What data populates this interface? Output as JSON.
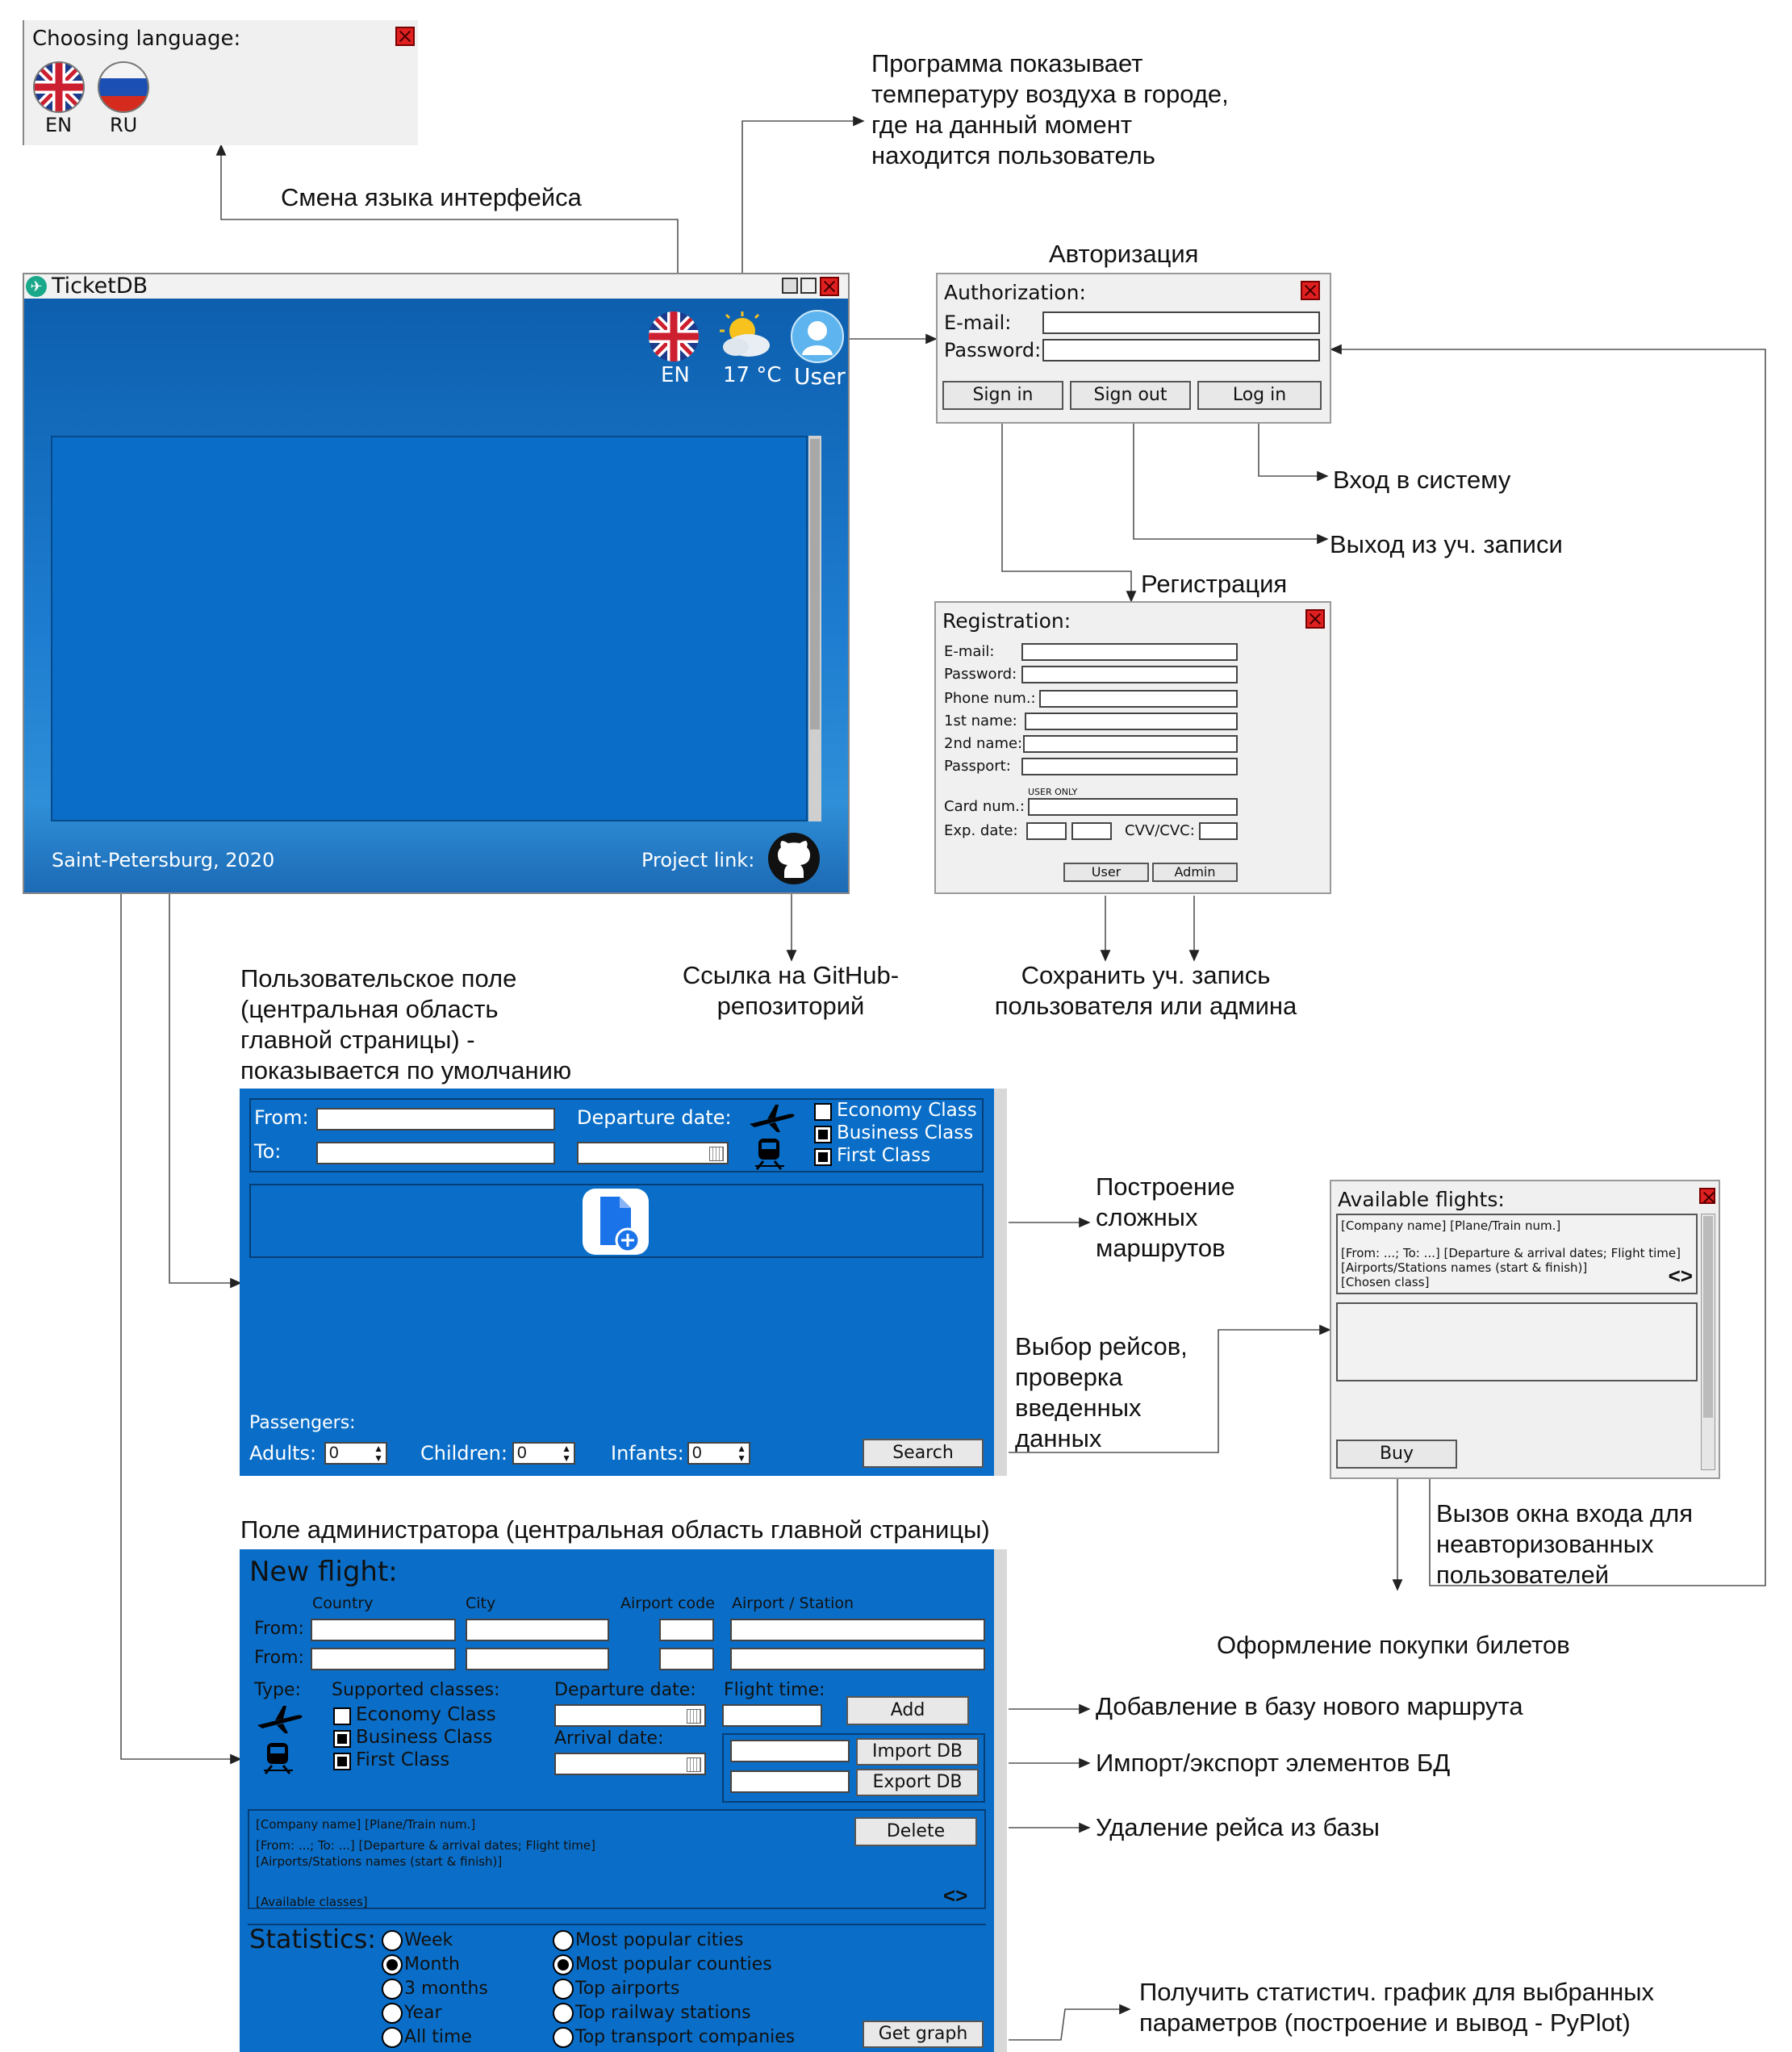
{
  "lang_window": {
    "title": "Choosing language:",
    "en": "EN",
    "ru": "RU"
  },
  "main_window": {
    "title": "TicketDB",
    "lang": "EN",
    "temperature": "17 °C",
    "user": "User",
    "footer_left": "Saint-Petersburg, 2020",
    "footer_right": "Project link:"
  },
  "auth_window": {
    "heading": "Авторизация",
    "title": "Authorization:",
    "email_label": "E-mail:",
    "password_label": "Password:",
    "sign_in": "Sign in",
    "sign_out": "Sign out",
    "log_in": "Log in"
  },
  "reg_window": {
    "heading": "Регистрация",
    "title": "Registration:",
    "email": "E-mail:",
    "password": "Password:",
    "phone": "Phone num.:",
    "first_name": "1st name:",
    "second_name": "2nd name:",
    "passport": "Passport:",
    "user_only": "USER ONLY",
    "card": "Card num.:",
    "exp": "Exp. date:",
    "cvv": "CVV/CVC:",
    "user_btn": "User",
    "admin_btn": "Admin"
  },
  "user_panel": {
    "from": "From:",
    "to": "To:",
    "departure": "Departure date:",
    "economy": "Economy Class",
    "business": "Business Class",
    "first": "First Class",
    "passengers": "Passengers:",
    "adults": "Adults:",
    "children": "Children:",
    "infants": "Infants:",
    "adults_val": "0",
    "children_val": "0",
    "infants_val": "0",
    "search": "Search"
  },
  "flights_window": {
    "title": "Available flights:",
    "line1": "[Company name]   [Plane/Train num.]",
    "line2": "[From: ...; To: ...]     [Departure & arrival dates; Flight time]",
    "line3": "[Airports/Stations names (start & finish)]",
    "line4": "[Chosen class]",
    "buy": "Buy"
  },
  "admin_panel": {
    "new_flight": "New flight:",
    "country": "Country",
    "city": "City",
    "airport_code": "Airport code",
    "airport_station": "Airport / Station",
    "from": "From:",
    "to": "From:",
    "type": "Type:",
    "supported": "Supported classes:",
    "economy": "Economy Class",
    "business": "Business Class",
    "first": "First Class",
    "departure": "Departure date:",
    "flight_time": "Flight time:",
    "arrival": "Arrival date:",
    "add": "Add",
    "import": "Import DB",
    "export": "Export DB",
    "rec1": "[Company name]     [Plane/Train num.]",
    "rec2": "[From: ...; To: ...]          [Departure & arrival dates; Flight time]",
    "rec3": "[Airports/Stations names (start & finish)]",
    "rec4": "[Available classes]",
    "delete": "Delete",
    "statistics": "Statistics:",
    "periods": [
      "Week",
      "Month",
      "3 months",
      "Year",
      "All time"
    ],
    "metrics": [
      "Most popular cities",
      "Most popular counties",
      "Top airports",
      "Top railway stations",
      "Top transport companies"
    ],
    "get_graph": "Get graph"
  },
  "annotations": {
    "change_lang": "Смена языка интерфейса",
    "temperature": "Программа показывает\nтемпературу воздуха в городе,\nгде на данный момент\nнаходится пользователь",
    "login": "Вход в систему",
    "logout": "Выход из уч. записи",
    "github": "Ссылка на GitHub-\nрепозиторий",
    "save": "Сохранить уч. запись\nпользователя или админа",
    "user_field": "Пользовательское поле\n(центральная область\nглавной страницы) -\nпоказывается по умолчанию",
    "routes": "Построение\nсложных\nмаршрутов",
    "choose": "Выбор рейсов,\nпроверка\nвведенных\nданных",
    "call_login": "Вызов окна входа для\nнеавторизованных\nпользователей",
    "purchase": "Оформление покупки билетов",
    "admin_field": "Поле администратора (центральная область главной страницы)",
    "add_route": "Добавление в базу нового маршрута",
    "import_export": "Импорт/экспорт элементов БД",
    "delete": "Удаление рейса из базы",
    "stats": "Получить статистич. график для выбранных\nпараметров (построение и вывод - PyPlot)"
  },
  "colors": {
    "panel_blue": "#0a6ec8",
    "close_red": "#e02020"
  }
}
